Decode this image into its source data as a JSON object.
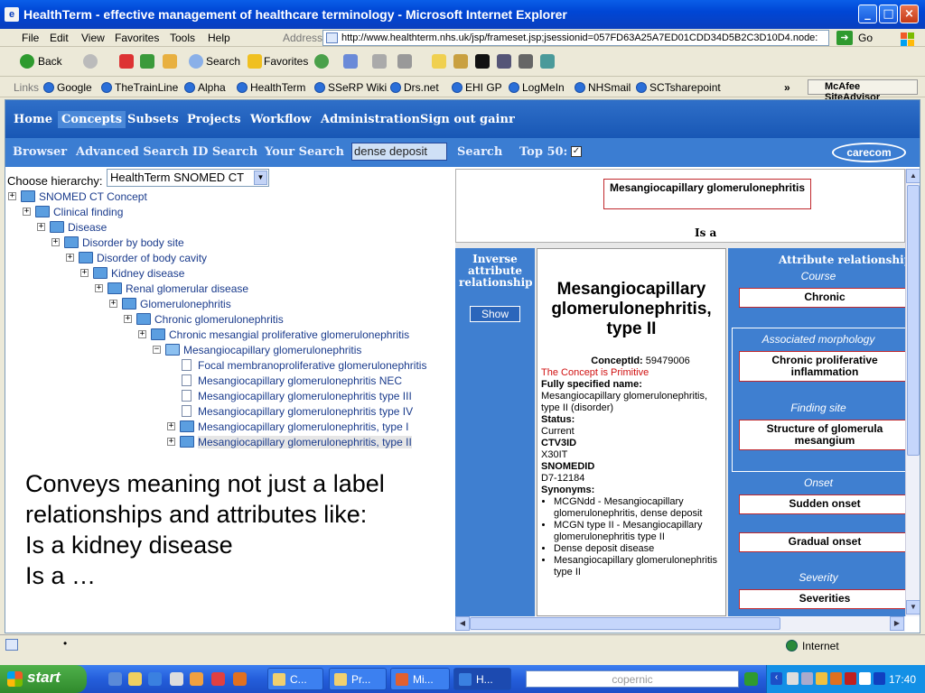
{
  "window": {
    "title": "HealthTerm - effective management of healthcare terminology - Microsoft Internet Explorer"
  },
  "menu": {
    "items": [
      "File",
      "Edit",
      "View",
      "Favorites",
      "Tools",
      "Help"
    ],
    "address_label": "Address",
    "url": "http://www.healthterm.nhs.uk/jsp/frameset.jsp;jsessionid=057FD63A25A7ED01CDD34D5B2C3D10D4.node:",
    "go_label": "Go"
  },
  "toolbar": {
    "back": "Back",
    "search": "Search",
    "favorites": "Favorites"
  },
  "links": {
    "label": "Links",
    "items": [
      "Google",
      "TheTrainLine",
      "Alpha",
      "HealthTerm",
      "SSeRP Wiki",
      "Drs.net",
      "EHI GP",
      "LogMeIn",
      "NHSmail",
      "SCTsharepoint"
    ],
    "chevron": "»",
    "mcafee": "McAfee SiteAdvisor"
  },
  "nav": {
    "main": [
      "Home",
      "Concepts",
      "Subsets",
      "Projects",
      "Workflow",
      "Administration",
      "Sign out gainr"
    ],
    "sub": {
      "browser": "Browser",
      "advanced": "Advanced Search",
      "id": "ID Search",
      "your": "Your Search",
      "search_value": "dense deposit",
      "search_btn": "Search",
      "top50": "Top 50:",
      "top50_checked": "✓"
    },
    "logo": "carecom"
  },
  "tree": {
    "choose_label": "Choose hierarchy:",
    "hierarchy": "HealthTerm SNOMED CT",
    "nodes": [
      "SNOMED CT Concept",
      "Clinical finding",
      "Disease",
      "Disorder by body site",
      "Disorder of body cavity",
      "Kidney disease",
      "Renal glomerular disease",
      "Glomerulonephritis",
      "Chronic glomerulonephritis",
      "Chronic mesangial proliferative glomerulonephritis",
      "Mesangiocapillary glomerulonephritis",
      "Focal membranoproliferative glomerulonephritis",
      "Mesangiocapillary glomerulonephritis NEC",
      "Mesangiocapillary glomerulonephritis type III",
      "Mesangiocapillary glomerulonephritis type IV",
      "Mesangiocapillary glomerulonephritis, type I",
      "Mesangiocapillary glomerulonephritis, type II"
    ],
    "plus": "+",
    "minus": "−"
  },
  "caption": {
    "lines": [
      "Conveys meaning not just a label",
      "relationships and attributes like:",
      "Is a kidney disease",
      "Is a …"
    ]
  },
  "concept": {
    "parent_box": "Mesangiocapillary glomerulonephritis",
    "isa": "Is a",
    "inverse_header": "Inverse attribute relationship",
    "show_btn": "Show",
    "title": "Mesangiocapillary glomerulonephritis, type II",
    "concept_id_label": "ConceptId:",
    "concept_id": "59479006",
    "primitive": "The Concept is Primitive",
    "fsn_label": "Fully specified name:",
    "fsn": "Mesangiocapillary glomerulonephritis, type II (disorder)",
    "status_label": "Status:",
    "status": "Current",
    "ctv3_label": "CTV3ID",
    "ctv3": "X30IT",
    "snomedid_label": "SNOMEDID",
    "snomedid": "D7-12184",
    "synonyms_label": "Synonyms:",
    "synonyms": [
      "MCGNdd - Mesangiocapillary glomerulonephritis, dense deposit",
      "MCGN type II - Mesangiocapillary glomerulonephritis type II",
      "Dense deposit disease",
      "Mesangiocapillary glomerulonephritis type II"
    ],
    "attr_header": "Attribute relationship",
    "course_label": "Course",
    "course": "Chronic",
    "morph_label": "Associated morphology",
    "morph": "Chronic proliferative inflammation",
    "site_label": "Finding site",
    "site": "Structure of glomerula mesangium",
    "onset_label": "Onset",
    "onset1": "Sudden onset",
    "onset2": "Gradual onset",
    "severity_label": "Severity",
    "severity": "Severities"
  },
  "status": {
    "zone": "Internet",
    "dot": "•"
  },
  "taskbar": {
    "start": "start",
    "tasks": [
      "C...",
      "Pr...",
      "Mi...",
      "H..."
    ],
    "search_placeholder": "copernic",
    "clock": "17:40"
  }
}
